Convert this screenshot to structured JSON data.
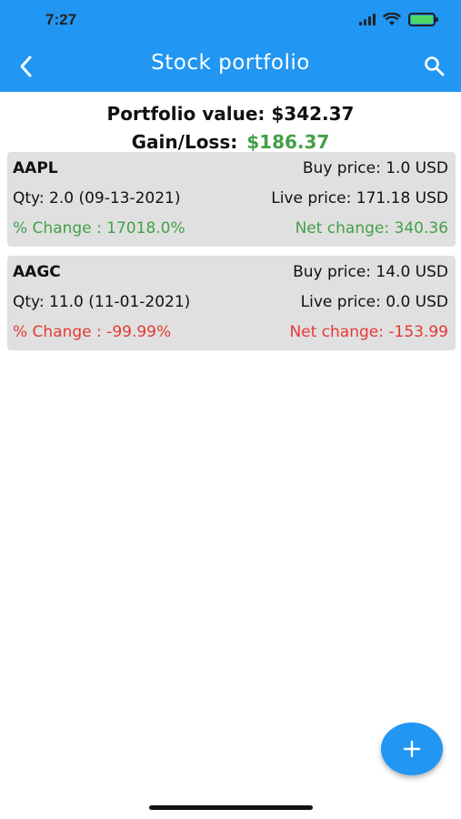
{
  "status_bar": {
    "time": "7:27"
  },
  "app_bar": {
    "title": "Stock portfolio",
    "back_icon": "back-arrow-icon",
    "search_icon": "search-icon"
  },
  "summary": {
    "portfolio_value_text": "Portfolio value: $342.37",
    "gain_label": "Gain/Loss:",
    "gain_value": "$186.37"
  },
  "holdings": [
    {
      "ticker": "AAPL",
      "buy_price": "Buy price: 1.0 USD",
      "qty": "Qty: 2.0 (09-13-2021)",
      "live_price": "Live price: 171.18 USD",
      "pct_change": "% Change : 17018.0%",
      "net_change": "Net change: 340.36",
      "trend_color": "#43a047"
    },
    {
      "ticker": "AAGC",
      "buy_price": "Buy price: 14.0 USD",
      "qty": "Qty: 11.0 (11-01-2021)",
      "live_price": "Live price: 0.0 USD",
      "pct_change": "% Change : -99.99%",
      "net_change": "Net change: -153.99",
      "trend_color": "#e53935"
    }
  ],
  "fab": {
    "icon": "plus-icon"
  },
  "colors": {
    "primary": "#2196f3",
    "gain": "#43a047",
    "loss": "#e53935",
    "card_bg": "#e0e0e0"
  }
}
